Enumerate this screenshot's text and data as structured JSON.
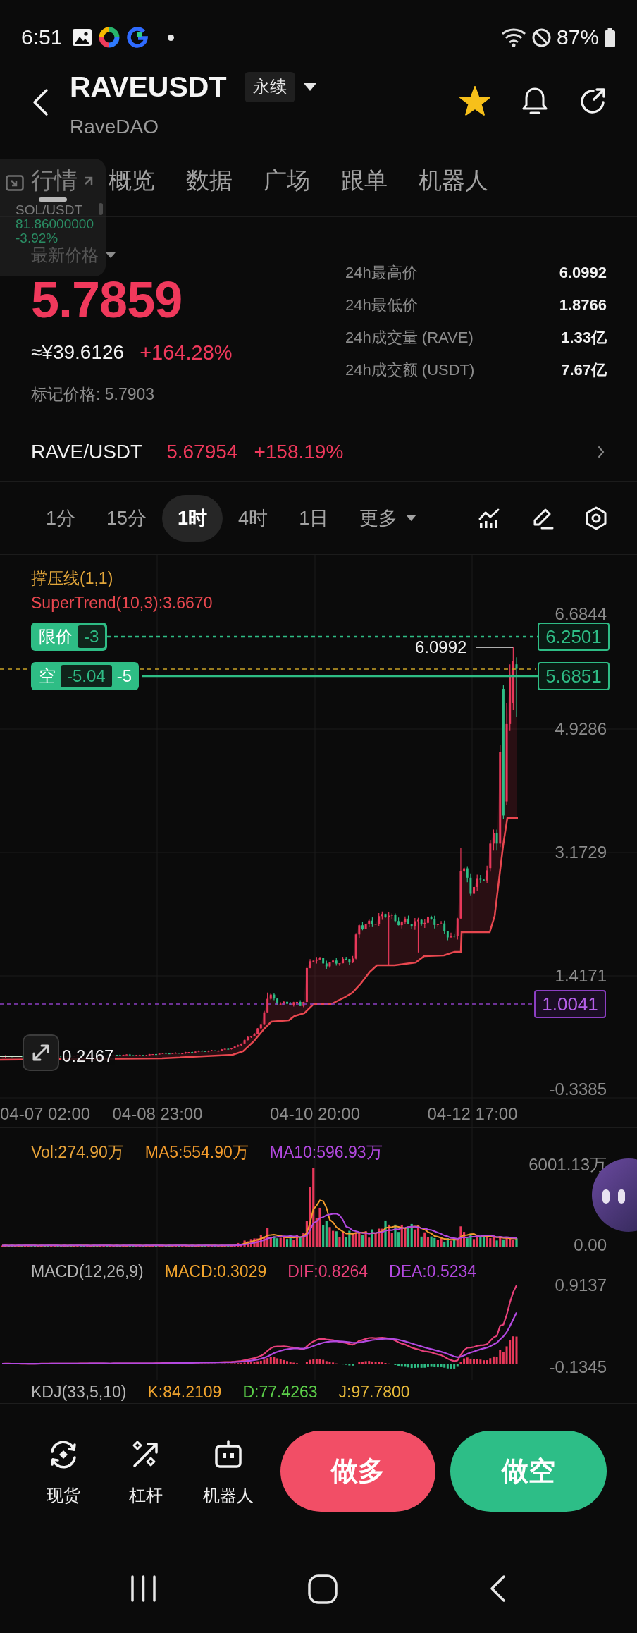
{
  "status_bar": {
    "time": "6:51",
    "battery": "87%"
  },
  "header": {
    "symbol": "RAVEUSDT",
    "contract_type": "永续",
    "name": "RaveDAO",
    "favorite": true
  },
  "tabs": [
    {
      "label": "行情",
      "selected": true
    },
    {
      "label": "概览",
      "selected": false
    },
    {
      "label": "数据",
      "selected": false
    },
    {
      "label": "广场",
      "selected": false
    },
    {
      "label": "跟单",
      "selected": false
    },
    {
      "label": "机器人",
      "selected": false
    }
  ],
  "floating_window": {
    "pair": "SOL/USDT",
    "price": "81.86000000",
    "change": "-3.92%"
  },
  "price": {
    "label": "最新价格",
    "last": "5.7859",
    "cny": "≈¥39.6126",
    "change": "+164.28%",
    "mark": "标记价格: 5.7903"
  },
  "stats": [
    {
      "label": "24h最高价",
      "value": "6.0992"
    },
    {
      "label": "24h最低价",
      "value": "1.8766"
    },
    {
      "label": "24h成交量 (RAVE)",
      "value": "1.33亿"
    },
    {
      "label": "24h成交额 (USDT)",
      "value": "7.67亿"
    }
  ],
  "spot": {
    "pair": "RAVE/USDT",
    "price": "5.67954",
    "change": "+158.19%"
  },
  "timeframes": [
    {
      "label": "1分",
      "selected": false
    },
    {
      "label": "15分",
      "selected": false
    },
    {
      "label": "1时",
      "selected": true
    },
    {
      "label": "4时",
      "selected": false
    },
    {
      "label": "1日",
      "selected": false
    }
  ],
  "more": "更多",
  "main_chart": {
    "indicators": [
      {
        "text": "撑压线(1,1)",
        "color": "#e2a63a"
      },
      {
        "text": "SuperTrend(10,3):3.6670",
        "color": "#e8474f"
      }
    ],
    "y_labels": [
      "6.6844",
      "4.9286",
      "3.1729",
      "1.4171",
      "-0.3385"
    ],
    "x_labels": [
      "04-07 02:00",
      "04-08 23:00",
      "04-10 20:00",
      "04-12 17:00"
    ],
    "orders": [
      {
        "kind": "limit",
        "label": "限价",
        "quantity": "-3",
        "price": "6.2501"
      },
      {
        "kind": "position",
        "label": "空",
        "pnl": "-5.04",
        "quantity": "-5",
        "price": "5.6851"
      }
    ],
    "high": "6.0992",
    "low": "0.2467",
    "alert_price": "1.0041"
  },
  "volume": {
    "legend": [
      {
        "text": "Vol:274.90万",
        "color": "#e8a43a"
      },
      {
        "text": "MA5:554.90万",
        "color": "#f29b2c"
      },
      {
        "text": "MA10:596.93万",
        "color": "#b349e0"
      }
    ],
    "max": "6001.13万",
    "min": "0.00"
  },
  "macd": {
    "legend": [
      {
        "text": "MACD(12,26,9)",
        "color": "#b4b4b4"
      },
      {
        "text": "MACD:0.3029",
        "color": "#f0a42e"
      },
      {
        "text": "DIF:0.8264",
        "color": "#e8407a"
      },
      {
        "text": "DEA:0.5234",
        "color": "#b349e0"
      }
    ],
    "max": "0.9137",
    "min": "-0.1345"
  },
  "kdj": {
    "legend": [
      {
        "text": "KDJ(33,5,10)",
        "color": "#b4b4b4"
      },
      {
        "text": "K:84.2109",
        "color": "#f0a42e"
      },
      {
        "text": "D:77.4263",
        "color": "#5ccf4a"
      },
      {
        "text": "J:97.7800",
        "color": "#e6b93a"
      }
    ]
  },
  "bottom_bar": {
    "shortcuts": [
      {
        "kind": "spot",
        "label": "现货"
      },
      {
        "kind": "margin",
        "label": "杠杆"
      },
      {
        "kind": "bot",
        "label": "机器人"
      }
    ],
    "buttons": [
      {
        "kind": "long",
        "label": "做多"
      },
      {
        "kind": "short",
        "label": "做空"
      }
    ]
  }
}
